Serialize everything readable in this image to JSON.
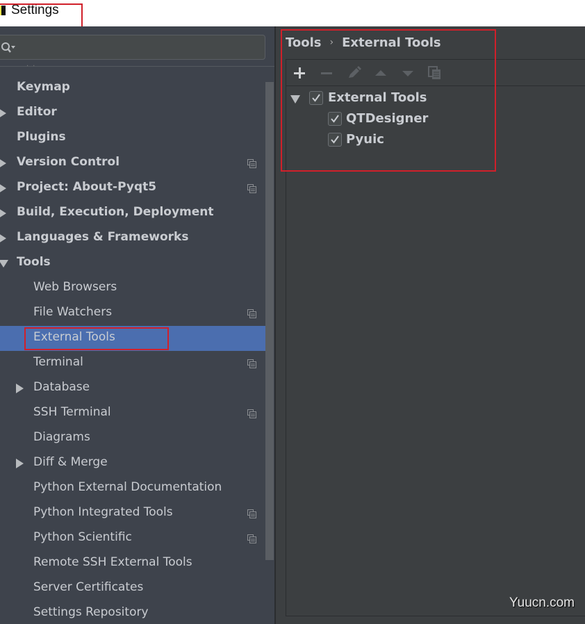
{
  "window": {
    "title": "Settings"
  },
  "search": {
    "placeholder": "",
    "value": ""
  },
  "sidebar": {
    "items": [
      {
        "label": "Keymap",
        "level": 0,
        "arrow": "none",
        "bold": true,
        "project_icon": false
      },
      {
        "label": "Editor",
        "level": 0,
        "arrow": "right",
        "bold": true,
        "project_icon": false
      },
      {
        "label": "Plugins",
        "level": 0,
        "arrow": "none",
        "bold": true,
        "project_icon": false
      },
      {
        "label": "Version Control",
        "level": 0,
        "arrow": "right",
        "bold": true,
        "project_icon": true
      },
      {
        "label": "Project: About-Pyqt5",
        "level": 0,
        "arrow": "right",
        "bold": true,
        "project_icon": true
      },
      {
        "label": "Build, Execution, Deployment",
        "level": 0,
        "arrow": "right",
        "bold": true,
        "project_icon": false
      },
      {
        "label": "Languages & Frameworks",
        "level": 0,
        "arrow": "right",
        "bold": true,
        "project_icon": false
      },
      {
        "label": "Tools",
        "level": 0,
        "arrow": "down",
        "bold": true,
        "project_icon": false
      },
      {
        "label": "Web Browsers",
        "level": 1,
        "arrow": "none",
        "bold": false,
        "project_icon": false
      },
      {
        "label": "File Watchers",
        "level": 1,
        "arrow": "none",
        "bold": false,
        "project_icon": true
      },
      {
        "label": "External Tools",
        "level": 1,
        "arrow": "none",
        "bold": false,
        "project_icon": false,
        "selected": true
      },
      {
        "label": "Terminal",
        "level": 1,
        "arrow": "none",
        "bold": false,
        "project_icon": true
      },
      {
        "label": "Database",
        "level": 1,
        "arrow": "right",
        "bold": false,
        "project_icon": false
      },
      {
        "label": "SSH Terminal",
        "level": 1,
        "arrow": "none",
        "bold": false,
        "project_icon": true
      },
      {
        "label": "Diagrams",
        "level": 1,
        "arrow": "none",
        "bold": false,
        "project_icon": false
      },
      {
        "label": "Diff & Merge",
        "level": 1,
        "arrow": "right",
        "bold": false,
        "project_icon": false
      },
      {
        "label": "Python External Documentation",
        "level": 1,
        "arrow": "none",
        "bold": false,
        "project_icon": false
      },
      {
        "label": "Python Integrated Tools",
        "level": 1,
        "arrow": "none",
        "bold": false,
        "project_icon": true
      },
      {
        "label": "Python Scientific",
        "level": 1,
        "arrow": "none",
        "bold": false,
        "project_icon": true
      },
      {
        "label": "Remote SSH External Tools",
        "level": 1,
        "arrow": "none",
        "bold": false,
        "project_icon": false
      },
      {
        "label": "Server Certificates",
        "level": 1,
        "arrow": "none",
        "bold": false,
        "project_icon": false
      },
      {
        "label": "Settings Repository",
        "level": 1,
        "arrow": "none",
        "bold": false,
        "project_icon": false
      }
    ]
  },
  "main": {
    "breadcrumb": {
      "parent": "Tools",
      "separator": "›",
      "current": "External Tools"
    },
    "toolbar": {
      "buttons": [
        {
          "name": "add",
          "icon": "plus-icon",
          "enabled": true
        },
        {
          "name": "remove",
          "icon": "minus-icon",
          "enabled": false
        },
        {
          "name": "edit",
          "icon": "pencil-icon",
          "enabled": false
        },
        {
          "name": "move-up",
          "icon": "arrow-up-icon",
          "enabled": false
        },
        {
          "name": "move-down",
          "icon": "arrow-down-icon",
          "enabled": false
        },
        {
          "name": "copy",
          "icon": "copy-icon",
          "enabled": false
        }
      ]
    },
    "tree": {
      "group": {
        "label": "External Tools",
        "checked": true,
        "expanded": true
      },
      "children": [
        {
          "label": "QTDesigner",
          "checked": true
        },
        {
          "label": "Pyuic",
          "checked": true
        }
      ]
    }
  },
  "watermark": "Yuucn.com",
  "colors": {
    "selection": "#4b6eaf",
    "sidebar_bg": "#3e434c",
    "panel_bg": "#3c3f41",
    "text": "#c9ccd1",
    "highlight_box": "#d0202a"
  }
}
